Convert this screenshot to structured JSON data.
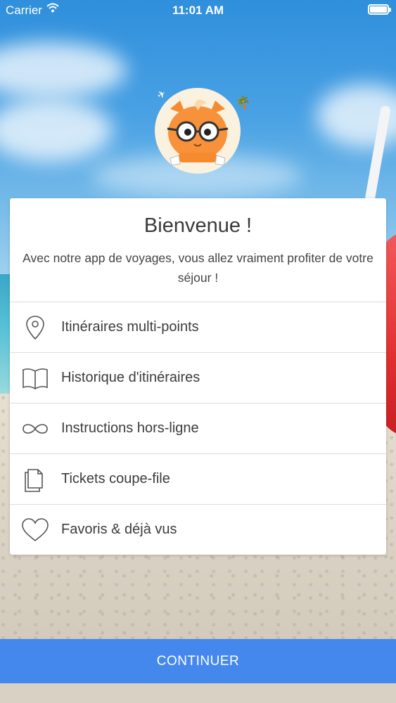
{
  "status_bar": {
    "carrier": "Carrier",
    "time": "11:01 AM"
  },
  "welcome": {
    "title": "Bienvenue !",
    "subtitle": "Avec notre app de voyages, vous allez vraiment profiter de votre séjour !"
  },
  "features": [
    {
      "label": "Itinéraires multi-points",
      "icon": "location-pin-icon"
    },
    {
      "label": "Historique d'itinéraires",
      "icon": "open-book-icon"
    },
    {
      "label": "Instructions hors-ligne",
      "icon": "infinity-icon"
    },
    {
      "label": "Tickets coupe-file",
      "icon": "documents-icon"
    },
    {
      "label": "Favoris & déjà vus",
      "icon": "heart-icon"
    }
  ],
  "cta": {
    "label": "CONTINUER"
  },
  "colors": {
    "accent": "#4488ee",
    "card": "#ffffff",
    "text": "#3c3c3c"
  }
}
